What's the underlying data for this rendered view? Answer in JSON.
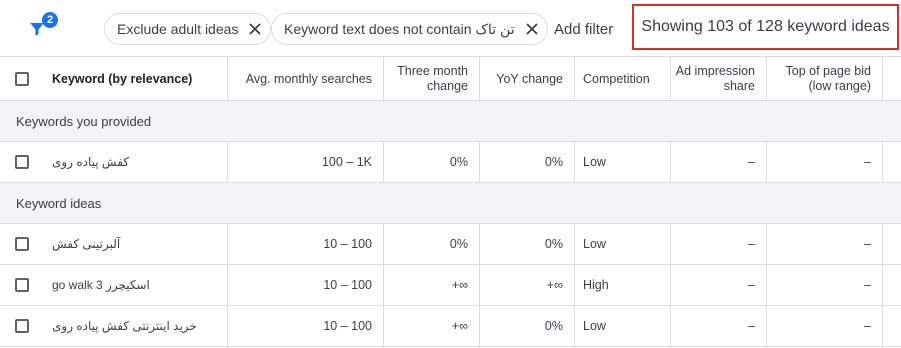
{
  "filter_badge": "2",
  "chips": [
    {
      "label": "Exclude adult ideas"
    },
    {
      "label": "Keyword text does not contain تن تاک"
    }
  ],
  "add_filter": "Add filter",
  "showing": "Showing 103 of 128 keyword ideas",
  "columns": {
    "keyword": "Keyword (by relevance)",
    "avg": "Avg. monthly searches",
    "three_month": [
      "Three month",
      "change"
    ],
    "yoy": "YoY change",
    "competition": "Competition",
    "impression": [
      "Ad impression",
      "share"
    ],
    "top_bid": [
      "Top of page bid",
      "(low range)"
    ]
  },
  "sections": {
    "provided": "Keywords you provided",
    "ideas": "Keyword ideas"
  },
  "rows": [
    {
      "keyword": "کفش پیاده روی",
      "avg": "100 – 1K",
      "three_month": "0%",
      "yoy": "0%",
      "competition": "Low",
      "impression": "–",
      "bid": "–"
    },
    {
      "keyword": "آلبرتینی کفش",
      "avg": "10 – 100",
      "three_month": "0%",
      "yoy": "0%",
      "competition": "Low",
      "impression": "–",
      "bid": "–"
    },
    {
      "keyword": "اسکیچرز go walk 3",
      "avg": "10 – 100",
      "three_month": "+∞",
      "yoy": "+∞",
      "competition": "High",
      "impression": "–",
      "bid": "–"
    },
    {
      "keyword": "خرید اینترنتی کفش پیاده روی",
      "avg": "10 – 100",
      "three_month": "+∞",
      "yoy": "0%",
      "competition": "Low",
      "impression": "–",
      "bid": "–"
    }
  ]
}
